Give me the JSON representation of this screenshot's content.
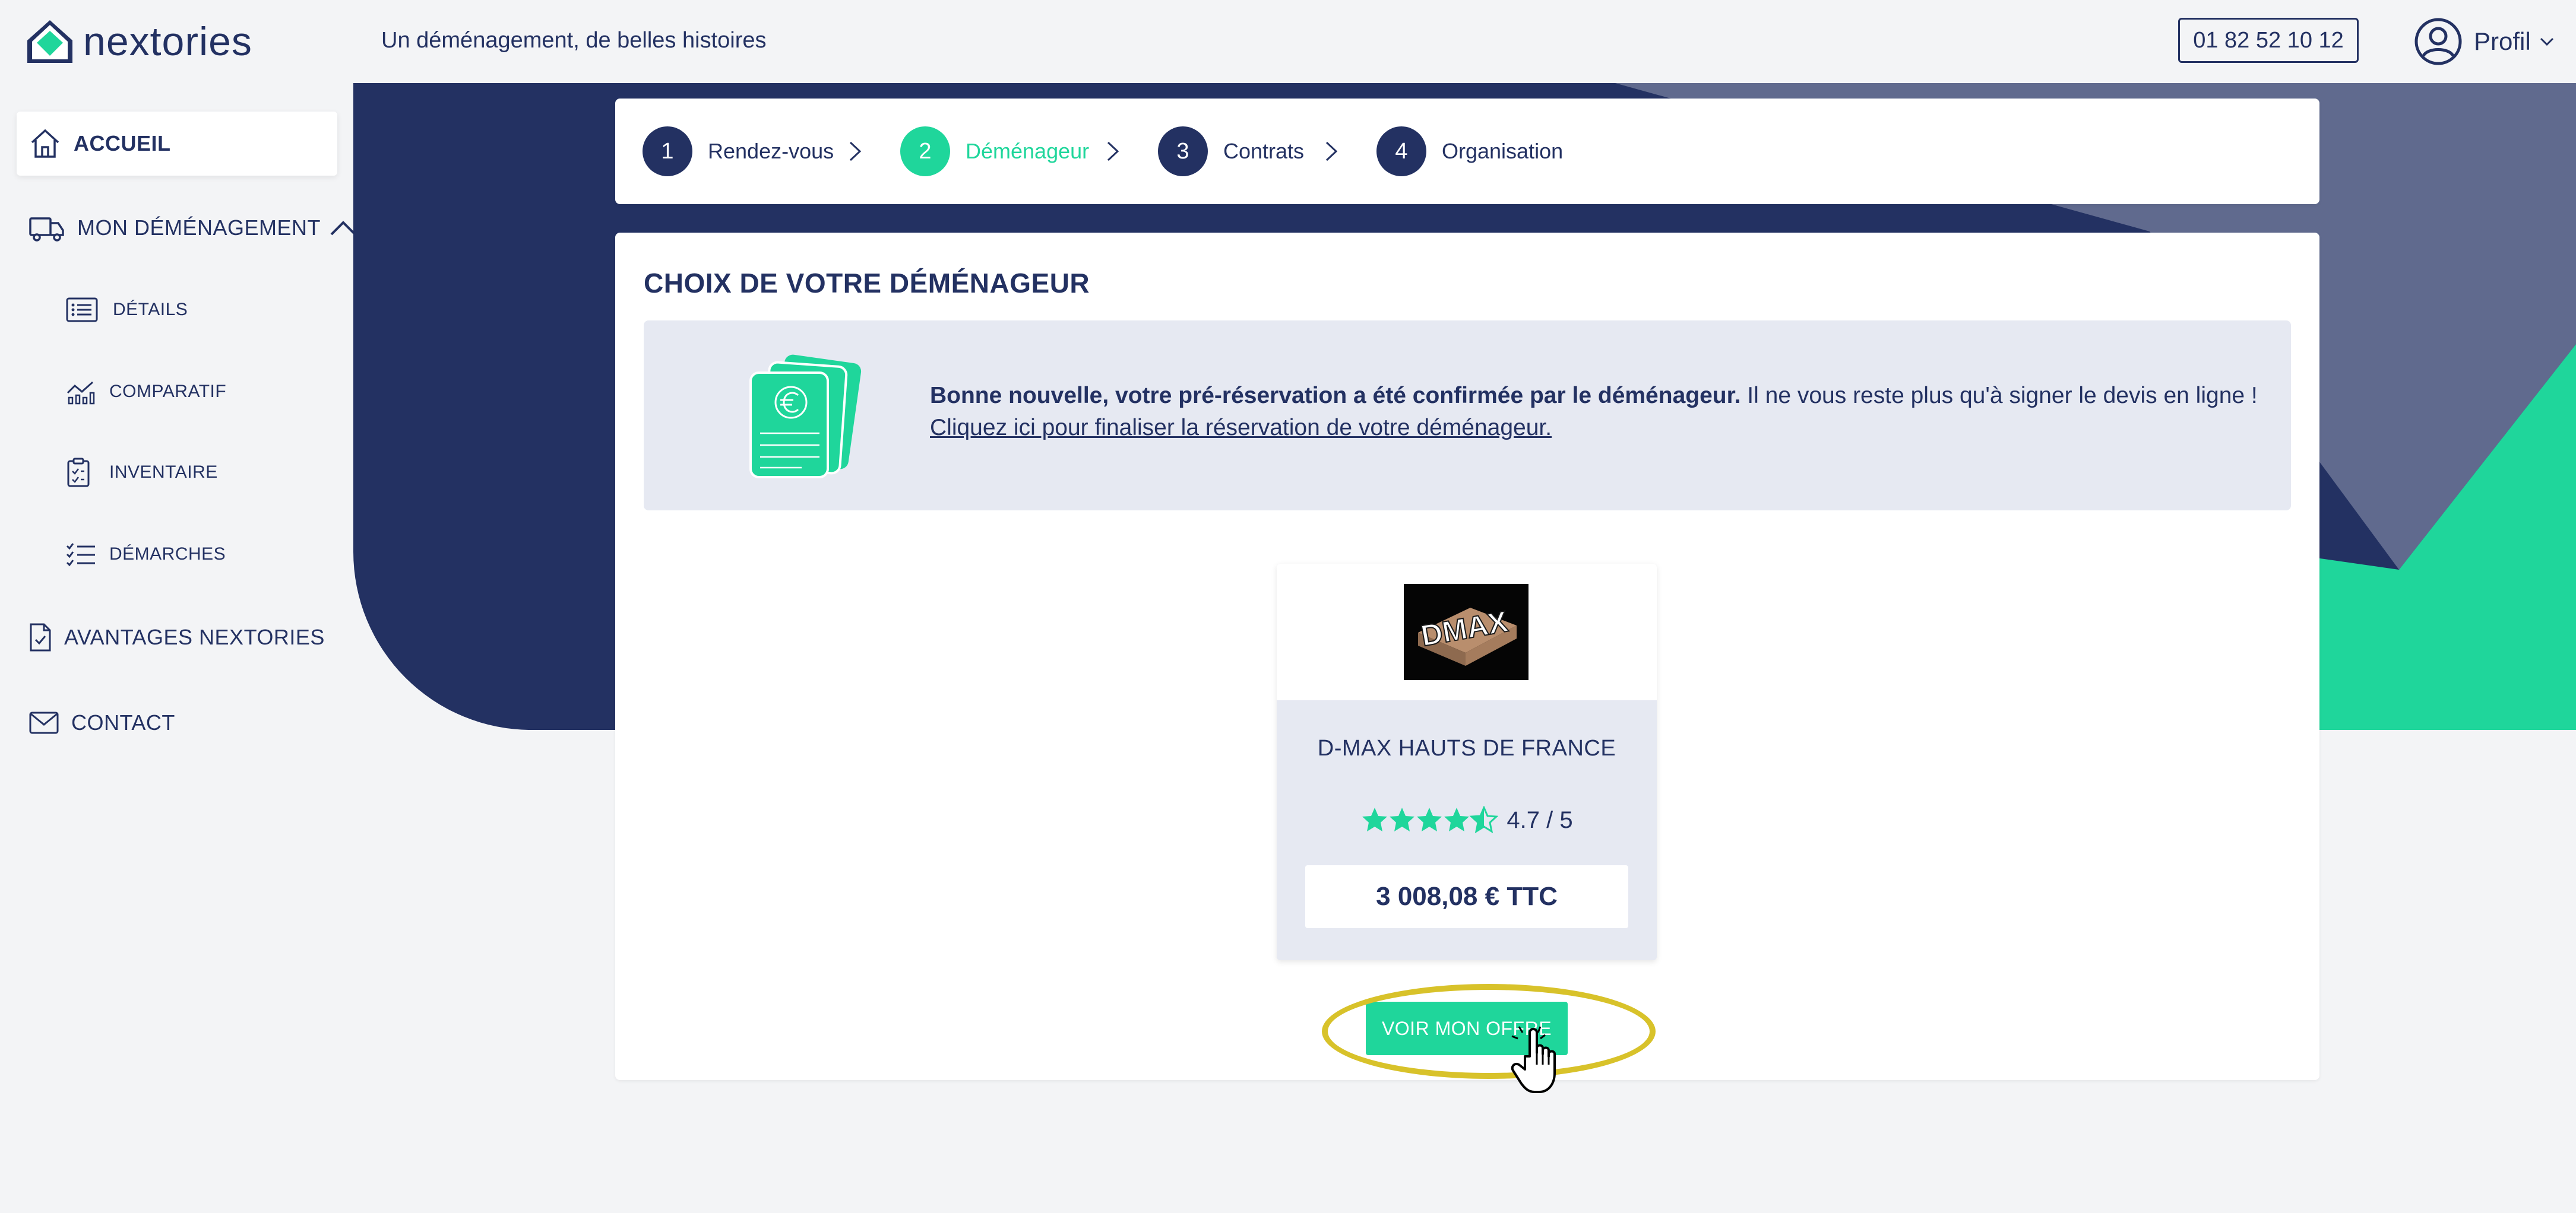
{
  "header": {
    "logo_text": "nextories",
    "tagline": "Un déménagement, de belles histoires",
    "phone": "01 82 52 10 12",
    "profile_label": "Profil"
  },
  "sidebar": {
    "home": "ACCUEIL",
    "move": "MON DÉMÉNAGEMENT",
    "sub": [
      "DÉTAILS",
      "COMPARATIF",
      "INVENTAIRE",
      "DÉMARCHES"
    ],
    "advantages": "AVANTAGES NEXTORIES",
    "contact": "CONTACT"
  },
  "stepper": {
    "steps": [
      {
        "num": "1",
        "label": "Rendez-vous"
      },
      {
        "num": "2",
        "label": "Déménageur"
      },
      {
        "num": "3",
        "label": "Contrats"
      },
      {
        "num": "4",
        "label": "Organisation"
      }
    ],
    "active_step": 2
  },
  "main": {
    "title": "CHOIX DE VOTRE DÉMÉNAGEUR",
    "notice_bold": "Bonne nouvelle, votre pré-réservation a été confirmée par le déménageur.",
    "notice_rest": " Il ne vous reste plus qu'à signer le devis en ligne !",
    "notice_link": "Cliquez ici pour finaliser la réservation de votre déménageur.",
    "mover": {
      "logo_text": "DMAX",
      "name": "D-MAX HAUTS DE FRANCE",
      "rating_value": 4.7,
      "rating_text": "4.7 / 5",
      "price": "3 008,08 € TTC"
    },
    "cta": "VOIR MON OFFRE"
  },
  "colors": {
    "navy": "#233162",
    "green": "#1fd69b",
    "highlight": "#d8c22a",
    "notice_bg": "#e6e9f2"
  }
}
